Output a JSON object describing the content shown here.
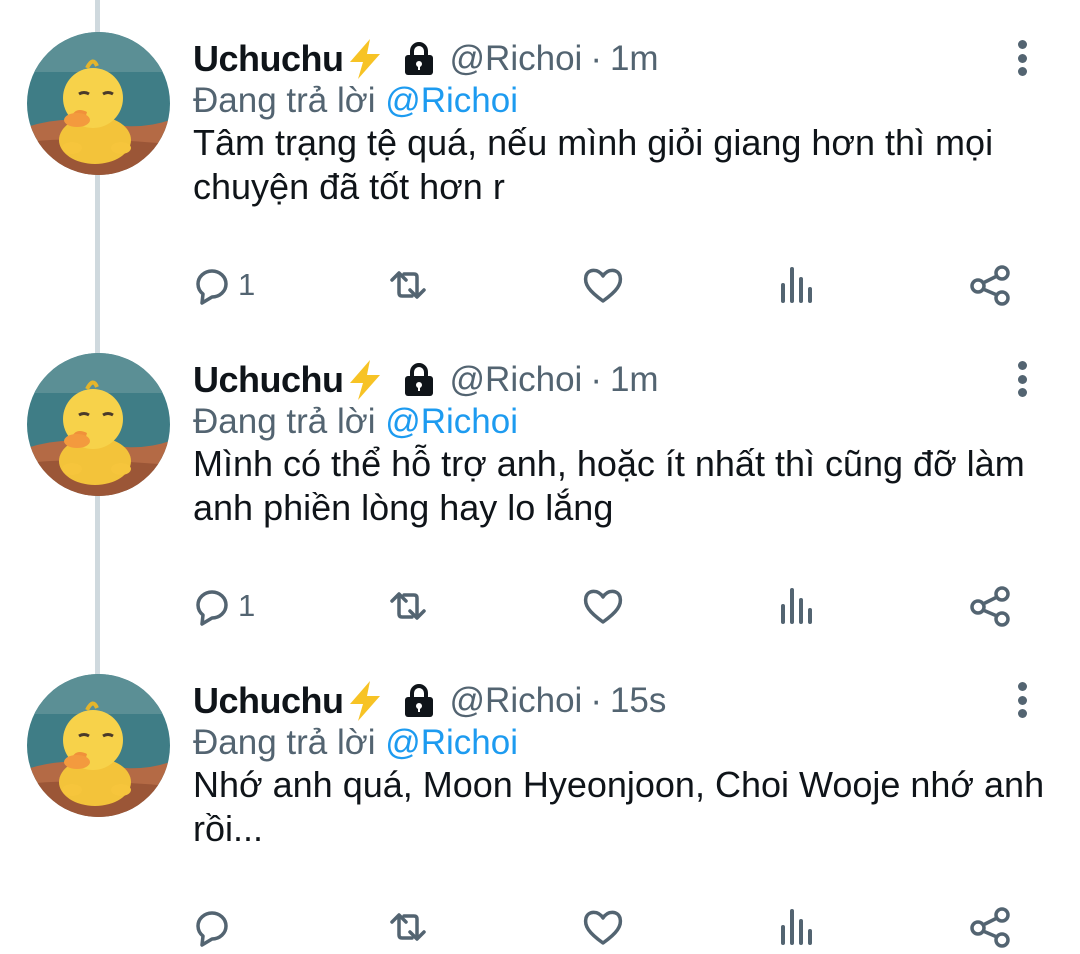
{
  "tweets": [
    {
      "name": "Uchuchu",
      "handle": "@Richoi",
      "separator": "·",
      "time": "1m",
      "replying_prefix": "Đang trả lời",
      "replying_to": "@Richoi",
      "text": "Tâm trạng tệ quá, nếu mình giỏi giang hơn thì mọi chuyện đã tốt hơn r",
      "reply_count": "1"
    },
    {
      "name": "Uchuchu",
      "handle": "@Richoi",
      "separator": "·",
      "time": "1m",
      "replying_prefix": "Đang trả lời",
      "replying_to": "@Richoi",
      "text": "Mình có thể hỗ trợ anh, hoặc ít nhất thì cũng đỡ làm anh phiền lòng hay lo lắng",
      "reply_count": "1"
    },
    {
      "name": "Uchuchu",
      "handle": "@Richoi",
      "separator": "·",
      "time": "15s",
      "replying_prefix": "Đang trả lời",
      "replying_to": "@Richoi",
      "text": "Nhớ anh quá, Moon Hyeonjoon, Choi Wooje nhớ anh rồi...",
      "reply_count": ""
    }
  ],
  "icons": {
    "badge": "lightning-bolt-icon",
    "protected": "lock-icon",
    "menu": "more-vertical-icon",
    "reply": "reply-icon",
    "retweet": "retweet-icon",
    "like": "heart-icon",
    "analytics": "analytics-icon",
    "share": "share-icon"
  },
  "colors": {
    "text_primary": "#0f1419",
    "text_secondary": "#536471",
    "mention": "#1d9bf0",
    "bolt": "#f7c325",
    "thread_line": "#cfd9de"
  }
}
